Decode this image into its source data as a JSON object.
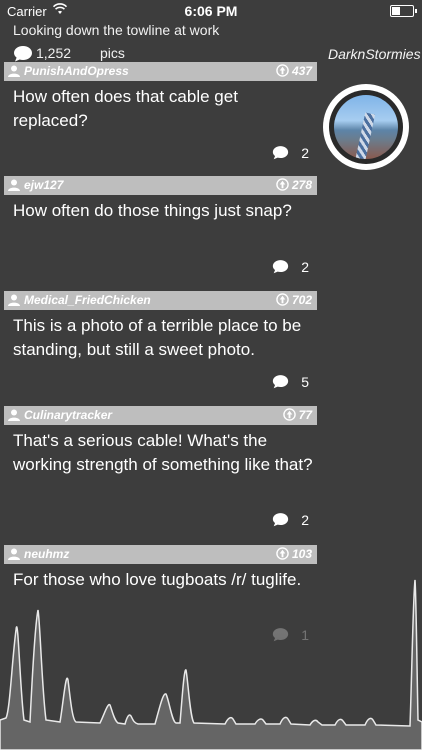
{
  "status_bar": {
    "carrier": "Carrier",
    "time": "6:06 PM"
  },
  "post": {
    "title": "Looking down the towline at work",
    "comment_count": "1,252",
    "type_label": "pics",
    "author": "DarknStormies"
  },
  "colors": {
    "background": "#3d3d3d",
    "header_bar": "#bebebe"
  },
  "icons": [
    "wifi-icon",
    "battery-icon",
    "comment-bubble-icon",
    "user-icon",
    "upvote-icon"
  ],
  "comments": [
    {
      "username": "PunishAndOpress",
      "score": "437",
      "text": "How often does that cable get replaced?",
      "replies": "2"
    },
    {
      "username": "ejw127",
      "score": "278",
      "text": "How often do those things just snap?",
      "replies": "2"
    },
    {
      "username": "Medical_FriedChicken",
      "score": "702",
      "text": "This is a photo of a terrible place to be standing, but still a sweet photo.",
      "replies": "5"
    },
    {
      "username": "Culinarytracker",
      "score": "77",
      "text": "That's a serious cable! What's the working strength of something like that?",
      "replies": "2"
    },
    {
      "username": "neuhmz",
      "score": "103",
      "text": "For those who love tugboats /r/ tuglife.",
      "replies": "1"
    }
  ]
}
